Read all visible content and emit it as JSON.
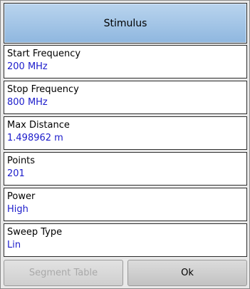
{
  "menu": {
    "title": "Stimulus",
    "items": [
      {
        "label": "Start Frequency",
        "value": "200 MHz"
      },
      {
        "label": "Stop Frequency",
        "value": "800 MHz"
      },
      {
        "label": "Max Distance",
        "value": "1.498962 m"
      },
      {
        "label": "Points",
        "value": "201"
      },
      {
        "label": "Power",
        "value": "High"
      },
      {
        "label": "Sweep Type",
        "value": "Lin"
      }
    ]
  },
  "buttons": {
    "segment_table": "Segment Table",
    "ok": "Ok"
  },
  "colors": {
    "title_bg": "#a3c5e7",
    "value_text": "#1c1ccb",
    "disabled_text": "#a9a9a9"
  }
}
